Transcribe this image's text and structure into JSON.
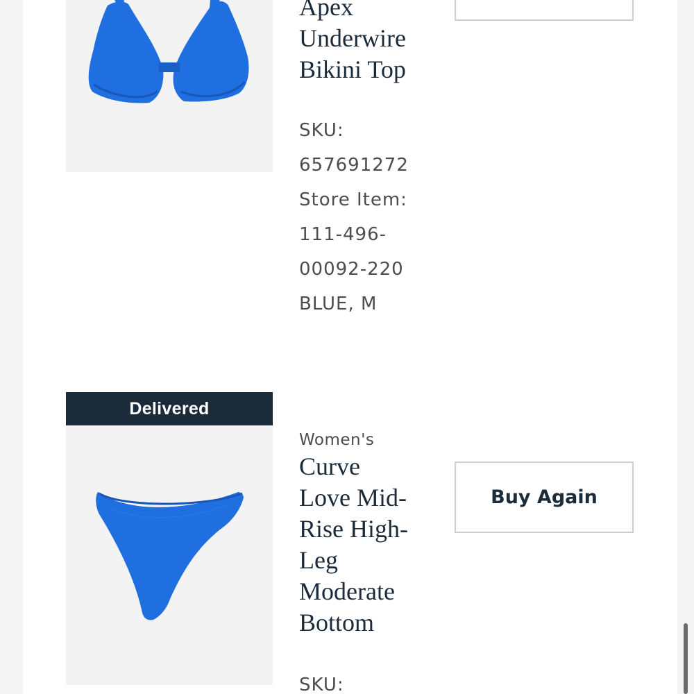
{
  "items": [
    {
      "title_lines": [
        "Apex",
        "Underwire",
        "Bikini Top"
      ],
      "sku_label": "SKU:",
      "sku_value": "657691272",
      "store_item_label": "Store Item:",
      "store_item_line1": "111-496-",
      "store_item_line2": "00092-220",
      "variant": "BLUE, M",
      "image_icon": "bikini-top-image"
    },
    {
      "status": "Delivered",
      "category": "Women's",
      "title_lines": [
        "Curve",
        "Love Mid-",
        "Rise High-",
        "Leg",
        "Moderate",
        "Bottom"
      ],
      "buy_again_label": "Buy Again",
      "sku_label": "SKU:",
      "image_icon": "bikini-bottom-image"
    }
  ],
  "colors": {
    "navy": "#1c2b3a",
    "product_blue": "#1f6fe0"
  }
}
